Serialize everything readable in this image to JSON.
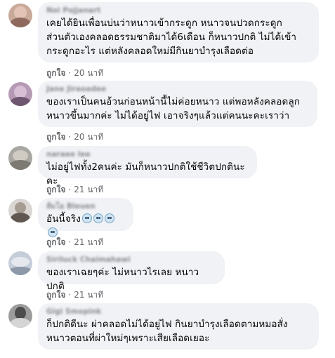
{
  "comments": [
    {
      "author": "Noi Pojjanart",
      "lines": "เคยได้ยินเพื่อนบ่นว่าหนาวเข้ากระดูก หนาวจนปวดกระดูก\nส่วนตัวเองคลอดธรรมชาติมาได้6เดือน ก็หนาวปกติ ไม่ได้เข้า\nกระดูกอะไร แต่หลังคลอดใหม่มีกินยาบำรุงเลือดต่อ",
      "like": "ถูกใจ",
      "time": "20 นาที"
    },
    {
      "author": "Jane Jiraoadee",
      "lines": "ของเราเป็นคนอ้วนก่อนหน้านี้ไม่ค่อยหนาว แต่พอหลังคลอดลูก\nหนาวขึ้นมากค่ะ ไม่ได้อยู่ไฟ เอาจริงๆแล้วแต่คนนะคะเราว่า",
      "like": "ถูกใจ",
      "time": "20 นาที"
    },
    {
      "author": "naraee lee",
      "lines": "ไม่อยู่ไฟทั้ง2คนค่ะ มันก็หนาวปกติใช้ชีวิตปกตินะคะ",
      "like": "ถูกใจ",
      "time": "21 นาที"
    },
    {
      "author": "ส้มโอ Bleuen",
      "lines": "อันนี้จริง",
      "emoji_count": 4,
      "like": "ถูกใจ",
      "time": "21 นาที"
    },
    {
      "author": "Siriluck Chaimahawi",
      "lines": "ของเราเฉยๆค่ะ ไม่หนาวไรเลย หนาวปกติ",
      "like": "ถูกใจ",
      "time": "21 นาที"
    },
    {
      "author": "Gigi Smopink",
      "lines": "ก็ปกติดีนะ ผ่าคลอดไม่ได้อยู่ไฟ กินยาบำรุงเลือดตามหมอสั่ง\nหนาวตอนที่ผ่าใหม่ๆเพราะเสียเลือดเยอะ",
      "like": "ถูกใจ",
      "time": "21 นาที"
    }
  ],
  "separator": "·",
  "emoji_icon": "cold-sweat-face-icon"
}
